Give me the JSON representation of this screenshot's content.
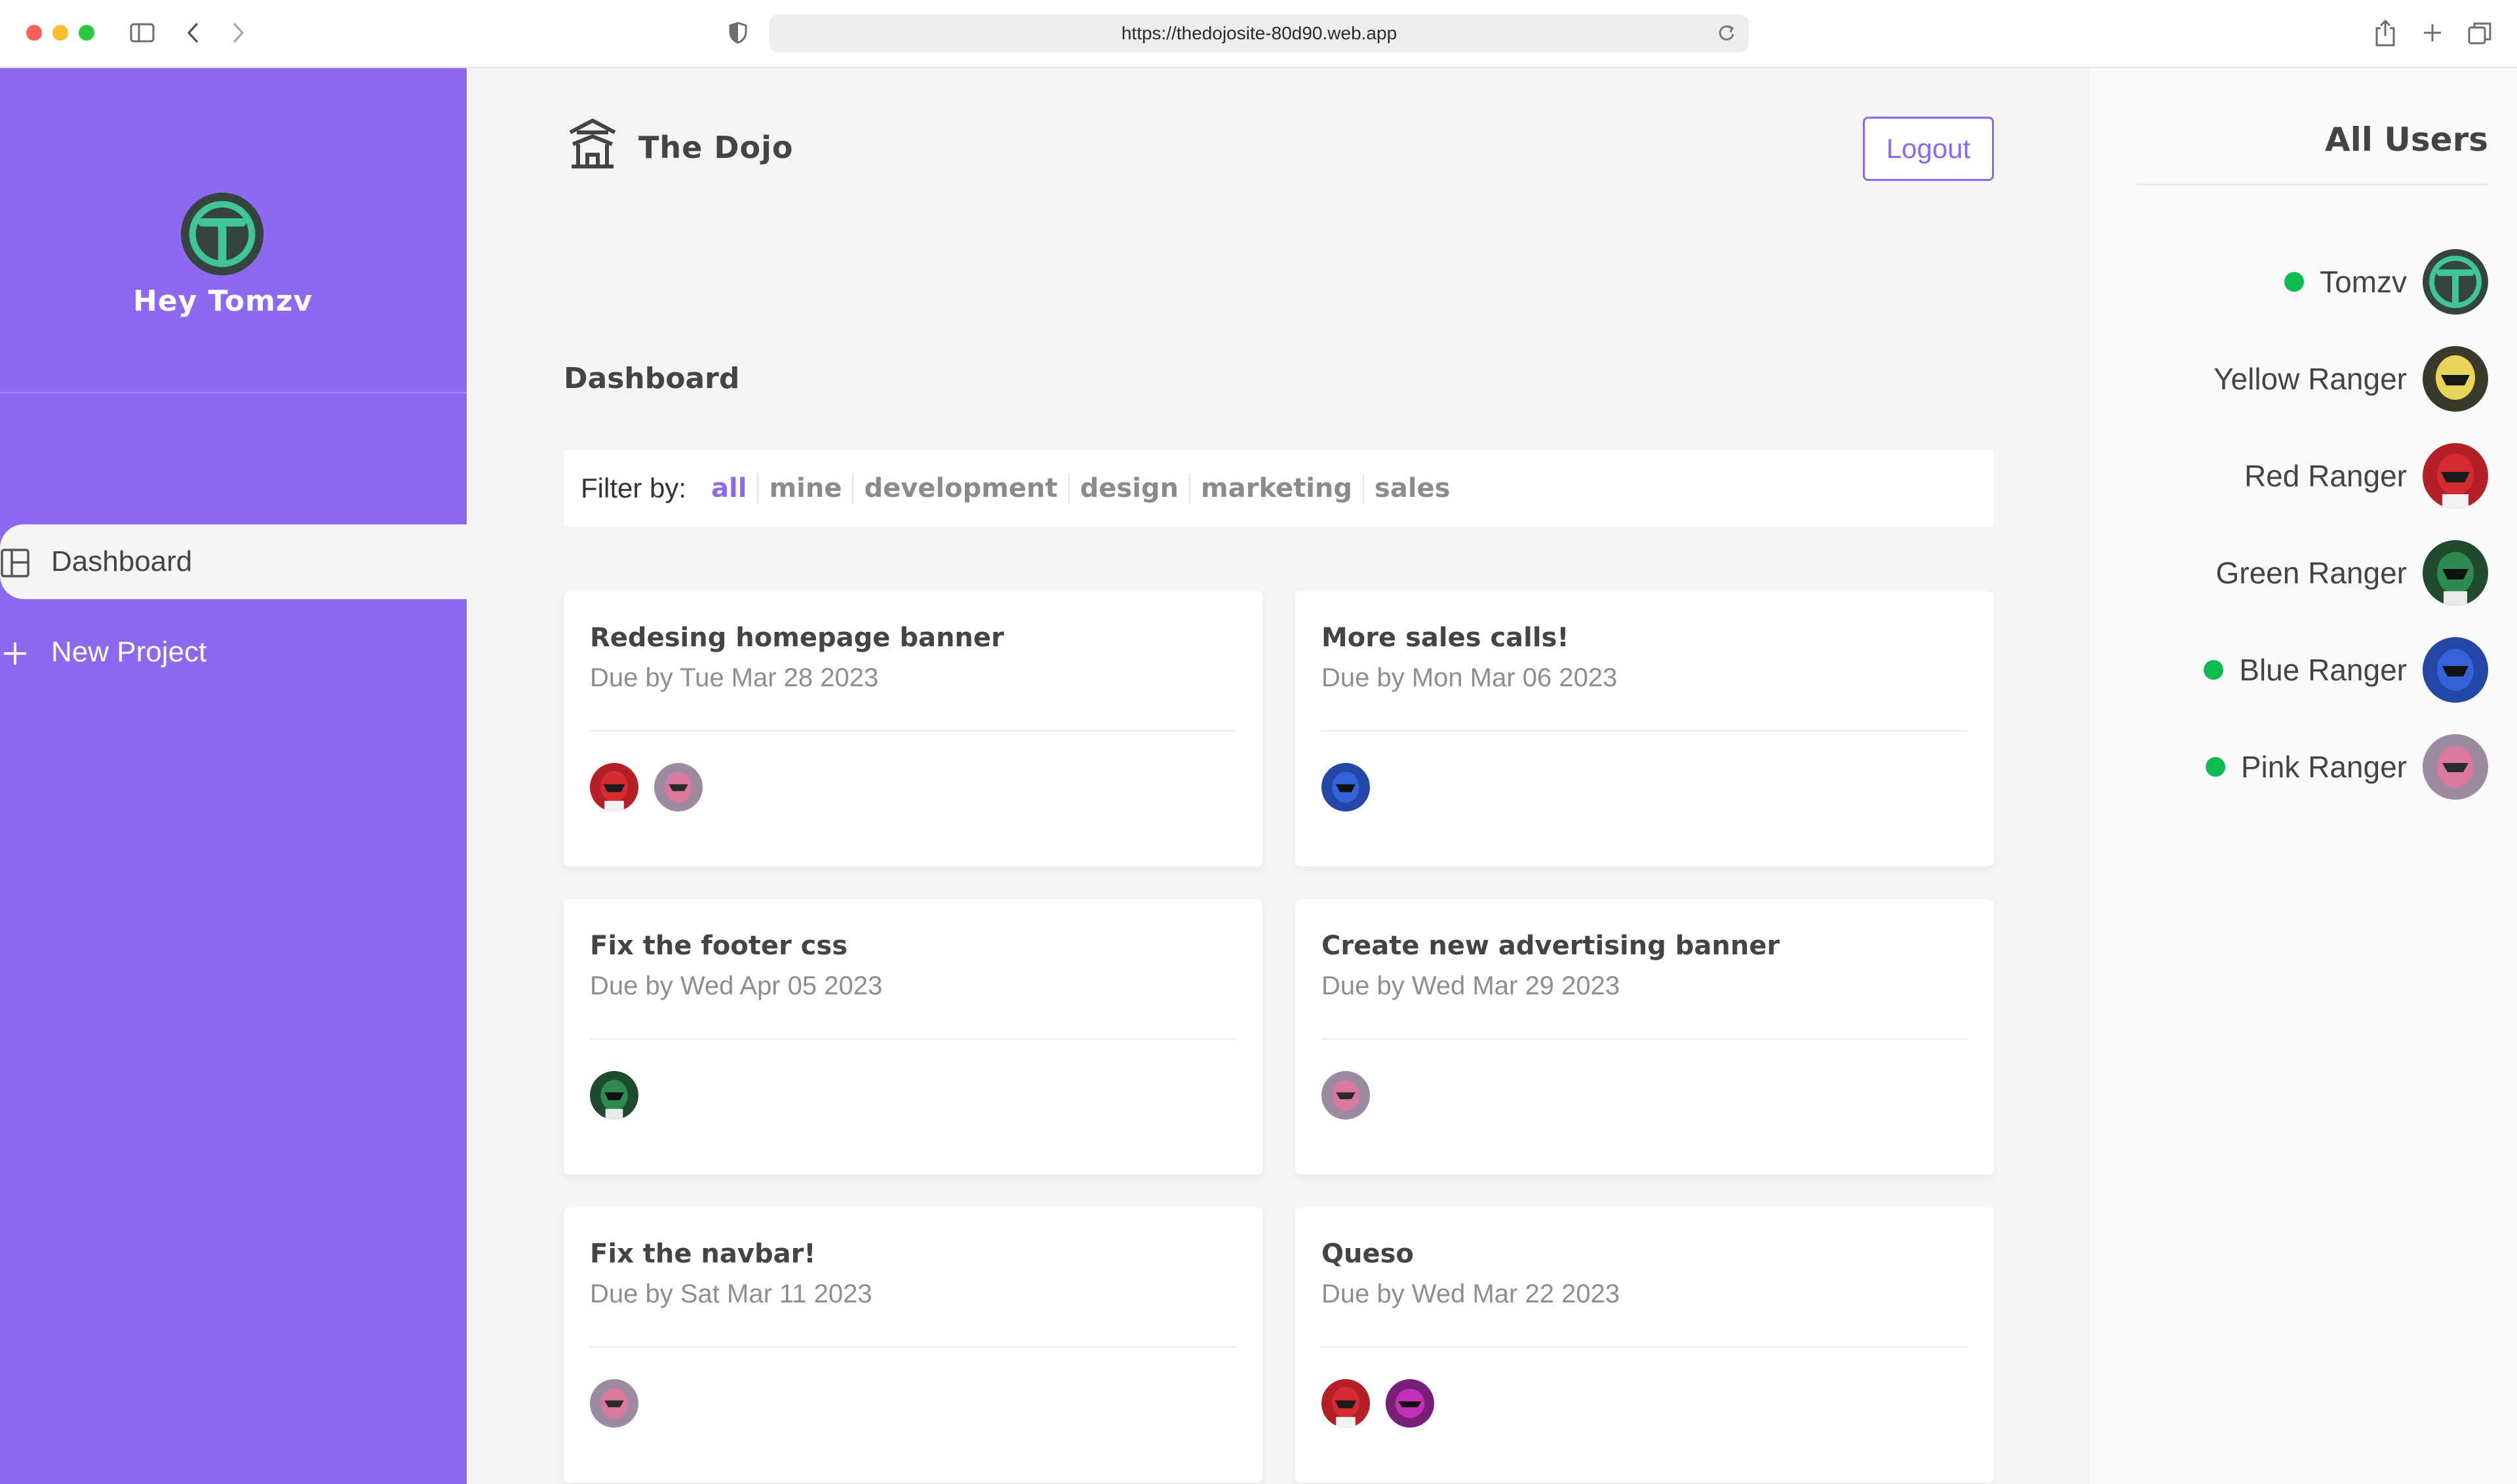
{
  "browser": {
    "url": "https://thedojosite-80d90.web.app"
  },
  "sidebar": {
    "greeting": "Hey Tomzv",
    "avatar": "tomzv-logo-avatar",
    "nav": [
      {
        "label": "Dashboard",
        "icon": "dashboard-icon",
        "active": true
      },
      {
        "label": "New Project",
        "icon": "plus-icon",
        "active": false
      }
    ]
  },
  "header": {
    "brand": "The Dojo",
    "logo_icon": "temple-icon",
    "logout_label": "Logout"
  },
  "dashboard": {
    "title": "Dashboard",
    "filter_label": "Filter by:",
    "filters": [
      "all",
      "mine",
      "development",
      "design",
      "marketing",
      "sales"
    ],
    "active_filter": "all",
    "projects": [
      {
        "title": "Redesing homepage banner",
        "due": "Due by Tue Mar 28 2023",
        "assigned": [
          "Red Ranger",
          "Pink Ranger"
        ]
      },
      {
        "title": "More sales calls!",
        "due": "Due by Mon Mar 06 2023",
        "assigned": [
          "Blue Ranger"
        ]
      },
      {
        "title": "Fix the footer css",
        "due": "Due by Wed Apr 05 2023",
        "assigned": [
          "Green Ranger"
        ]
      },
      {
        "title": "Create new advertising banner",
        "due": "Due by Wed Mar 29 2023",
        "assigned": [
          "Pink Ranger"
        ]
      },
      {
        "title": "Fix the navbar!",
        "due": "Due by Sat Mar 11 2023",
        "assigned": [
          "Pink Ranger"
        ]
      },
      {
        "title": "Queso",
        "due": "Due by Wed Mar 22 2023",
        "assigned": [
          "Red Ranger",
          "Magenta Ranger"
        ]
      }
    ]
  },
  "users_panel": {
    "title": "All Users",
    "users": [
      {
        "name": "Tomzv",
        "online": true,
        "avatar": "tomzv-logo-avatar"
      },
      {
        "name": "Yellow Ranger",
        "online": false,
        "avatar": "yellow-ranger-avatar"
      },
      {
        "name": "Red Ranger",
        "online": false,
        "avatar": "red-ranger-avatar"
      },
      {
        "name": "Green Ranger",
        "online": false,
        "avatar": "green-ranger-avatar"
      },
      {
        "name": "Blue Ranger",
        "online": true,
        "avatar": "blue-ranger-avatar"
      },
      {
        "name": "Pink Ranger",
        "online": true,
        "avatar": "pink-ranger-avatar"
      }
    ]
  },
  "colors": {
    "sidebar": "#8d69f1",
    "accent": "#8d69f1",
    "online": "#0ebb50",
    "background": "#f4f4f4"
  }
}
